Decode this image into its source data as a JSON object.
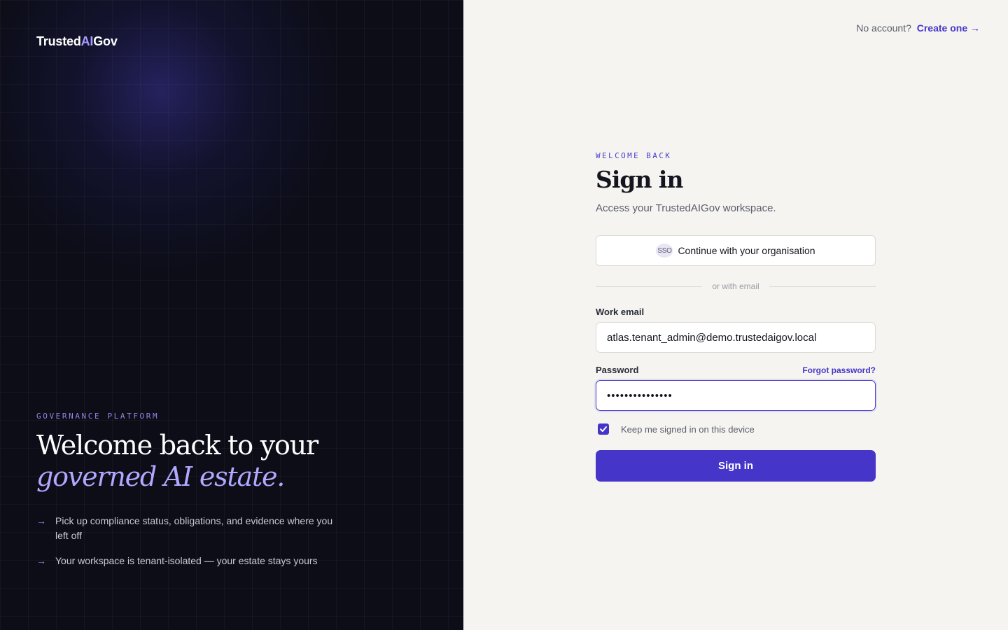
{
  "brand": {
    "prefix": "Trusted",
    "accent": "AI",
    "suffix": "Gov"
  },
  "left": {
    "eyebrow": "GOVERNANCE PLATFORM",
    "headline_plain": "Welcome back to your ",
    "headline_italic": "governed AI estate.",
    "bullets": [
      {
        "icon": "arrow-right-icon",
        "text": "Pick up compliance status, obligations, and evidence where you left off"
      },
      {
        "icon": "arrow-right-icon",
        "text": "Your workspace is tenant-isolated — your estate stays yours"
      }
    ]
  },
  "header": {
    "prompt": "No account?",
    "link_label": "Create one →"
  },
  "form": {
    "eyebrow": "WELCOME BACK",
    "title": "Sign in",
    "subtitle": "Access your TrustedAIGov workspace.",
    "sso_badge": "SSO",
    "sso_label": "Continue with your organisation",
    "divider_label": "or with email",
    "email_label": "Work email",
    "email_value": "atlas.tenant_admin@demo.trustedaigov.local",
    "password_label": "Password",
    "forgot_label": "Forgot password?",
    "password_mask": "•••••••••••••••",
    "remember_label": "Keep me signed in on this device",
    "remember_checked": true,
    "submit_label": "Sign in"
  },
  "colors": {
    "accent": "#4536c9",
    "left_bg": "#0c0d17",
    "right_bg": "#f6f4f0",
    "accent_light": "#b1a8ff"
  }
}
